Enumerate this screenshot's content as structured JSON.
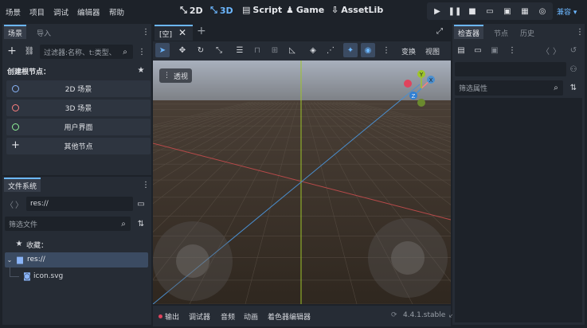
{
  "menu": [
    "场景",
    "项目",
    "调试",
    "编辑器",
    "帮助"
  ],
  "modes": [
    {
      "label": "2D",
      "icon": "2d-icon",
      "active": false
    },
    {
      "label": "3D",
      "icon": "3d-icon",
      "active": true
    },
    {
      "label": "Script",
      "icon": "script-icon",
      "active": false
    },
    {
      "label": "Game",
      "icon": "game-icon",
      "active": false
    },
    {
      "label": "AssetLib",
      "icon": "assetlib-icon",
      "active": false
    }
  ],
  "compat_label": "兼容",
  "scene_dock": {
    "tabs": [
      "场景",
      "导入"
    ],
    "filter_placeholder": "过滤器:名称、t:类型、",
    "create_root_label": "创建根节点：",
    "root_buttons": [
      {
        "label": "2D 场景",
        "color": "#8ab4f8"
      },
      {
        "label": "3D 场景",
        "color": "#fc7f7f"
      },
      {
        "label": "用户界面",
        "color": "#8eef97"
      },
      {
        "label": "其他节点",
        "color": ""
      }
    ]
  },
  "filesystem_dock": {
    "tab": "文件系统",
    "path": "res://",
    "filter_placeholder": "筛选文件",
    "favorites_label": "收藏：",
    "root_folder": "res://",
    "files": [
      "icon.svg"
    ]
  },
  "editor_tabs": {
    "scene_tab": "[空]"
  },
  "viewport_toolbar": {
    "transform_label": "变换",
    "view_label": "视图"
  },
  "viewport": {
    "perspective_label": "透视",
    "gizmo": {
      "x": "X",
      "y": "Y",
      "z": "Z"
    }
  },
  "inspector": {
    "tabs": [
      "检查器",
      "节点",
      "历史"
    ],
    "filter_placeholder": "筛选属性"
  },
  "bottom_panel": {
    "tabs": [
      "输出",
      "调试器",
      "音频",
      "动画",
      "着色器编辑器"
    ],
    "version": "4.4.1.stable"
  }
}
